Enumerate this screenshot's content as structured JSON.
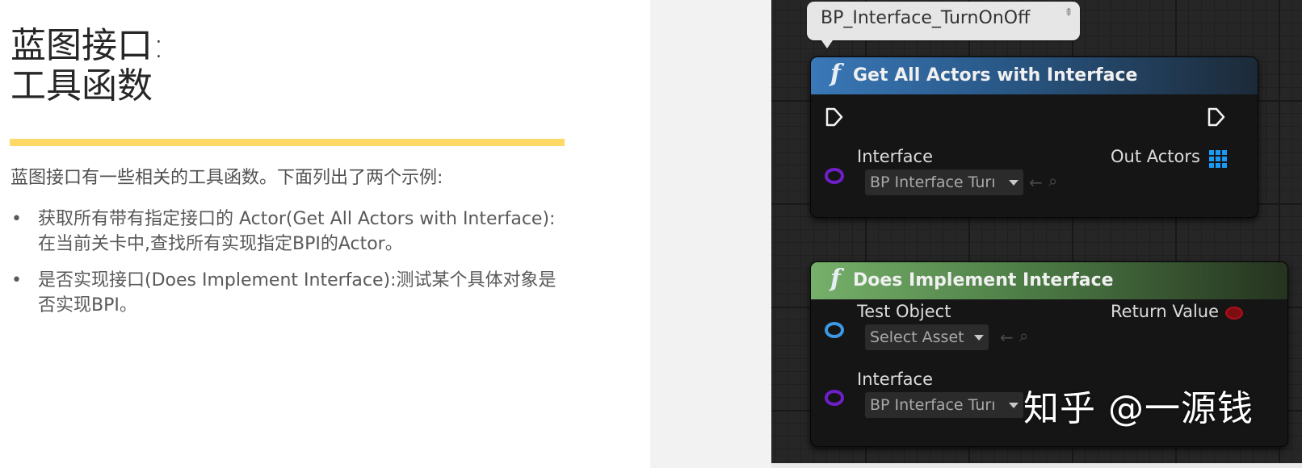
{
  "slide": {
    "title_line1": "蓝图接口:",
    "title_line2": "工具函数",
    "intro": "蓝图接口有一些相关的工具函数。下面列出了两个示例:",
    "bullets": [
      "获取所有带有指定接口的 Actor(Get All Actors with Interface):在当前关卡中,查找所有实现指定BPI的Actor。",
      "是否实现接口(Does Implement Interface):测试某个具体对象是否实现BPI。"
    ],
    "bullet_symbol": "•"
  },
  "blueprint": {
    "comment": "BP_Interface_TurnOnOff",
    "node_get_all": {
      "fn_icon": "f",
      "title": "Get All Actors with Interface",
      "input_label": "Interface",
      "input_value": "BP Interface Turı",
      "output_label": "Out Actors"
    },
    "node_does_implement": {
      "fn_icon": "f",
      "title": "Does Implement Interface",
      "test_object_label": "Test Object",
      "test_object_value": "Select Asset",
      "return_label": "Return Value",
      "interface_label": "Interface",
      "interface_value": "BP Interface Turı"
    },
    "icons": {
      "use_selected": "←",
      "browse": "⌕",
      "pin": "⇞"
    }
  },
  "watermark": "知乎 @一源钱",
  "colors": {
    "accent_bar": "#ffd966",
    "node1_header": "#3a78b8",
    "node2_header": "#76b06a",
    "interface_pin": "#6e1fc9",
    "object_pin": "#3d98e6",
    "bool_pin": "#b01018",
    "array_pin": "#1b9af5"
  }
}
